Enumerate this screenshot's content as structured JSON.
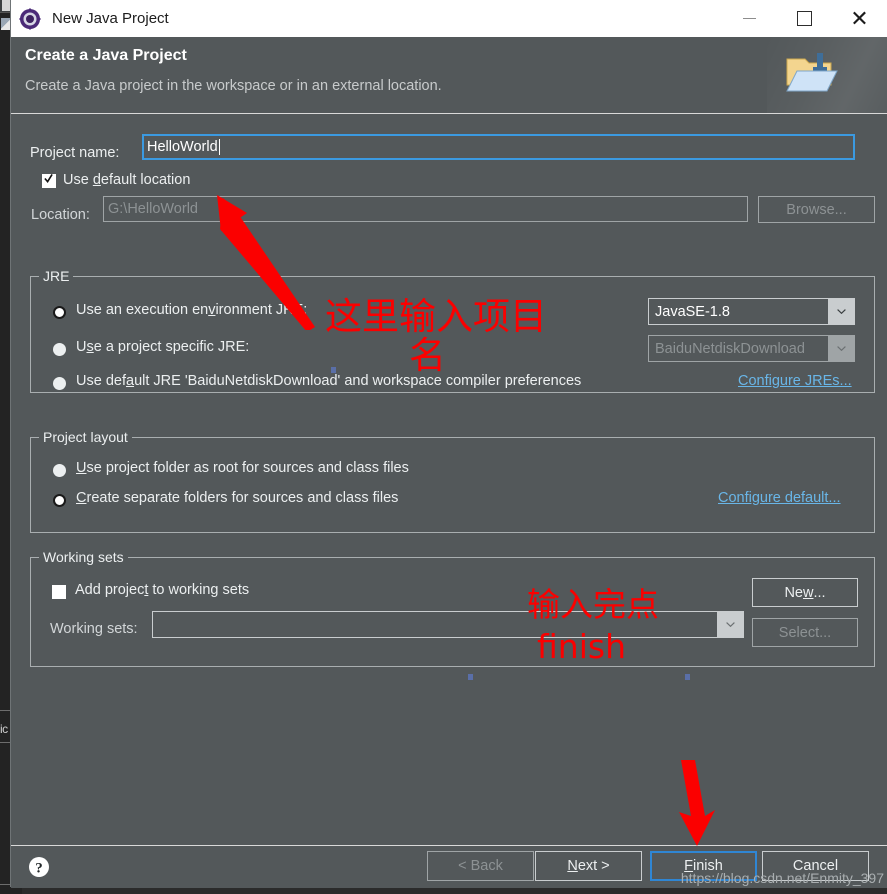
{
  "window": {
    "title": "New Java Project",
    "icon": "eclipse-wizard-icon",
    "minimize_label": "—",
    "maximize_label": "□",
    "close_label": "✕"
  },
  "header": {
    "title": "Create a Java Project",
    "subtitle": "Create a Java project in the workspace or in an external location.",
    "banner_icon": "new-java-project-folder-icon"
  },
  "form": {
    "project_name_label": "Project name:",
    "project_name_value": "HelloWorld",
    "use_default_location_label": "Use default location",
    "use_default_location_checked": true,
    "location_label": "Location:",
    "location_value": "G:\\HelloWorld",
    "browse_label": "Browse...",
    "browse_enabled": false
  },
  "jre": {
    "legend": "JRE",
    "option_exec_env_label": "Use an execution environment JRE:",
    "option_exec_env_selected": true,
    "option_specific_label": "Use a project specific JRE:",
    "option_specific_selected": false,
    "option_default_label": "Use default JRE 'BaiduNetdiskDownload' and workspace compiler preferences",
    "option_default_selected": false,
    "exec_env_value": "JavaSE-1.8",
    "specific_jre_value": "BaiduNetdiskDownload",
    "specific_jre_enabled": false,
    "configure_link": "Configure JREs..."
  },
  "project_layout": {
    "legend": "Project layout",
    "option_root_label": "Use project folder as root for sources and class files",
    "option_root_selected": false,
    "option_separate_label": "Create separate folders for sources and class files",
    "option_separate_selected": true,
    "configure_link": "Configure default..."
  },
  "working_sets": {
    "legend": "Working sets",
    "add_to_working_sets_label": "Add project to working sets",
    "add_to_working_sets_checked": false,
    "working_sets_label": "Working sets:",
    "working_sets_value": "",
    "new_label": "New...",
    "select_label": "Select...",
    "select_enabled": false
  },
  "footer": {
    "help_icon": "help-question-icon",
    "back_label": "< Back",
    "back_enabled": false,
    "next_label": "Next >",
    "finish_label": "Finish",
    "cancel_label": "Cancel",
    "default_button": "Finish"
  },
  "annotations": {
    "note_project_name": "这里输入项目\n名",
    "note_finish_line1": "输入完点",
    "note_finish_line2": "finish",
    "arrow_color": "#fb0000",
    "watermark": "https://blog.csdn.net/Enmity_397"
  },
  "background": {
    "side_text": "ic"
  },
  "colors": {
    "dialog_bg": "#53585a",
    "titlebar_bg": "#ffffff",
    "accent_blue": "#3b9ae1",
    "link_blue": "#69b6e8",
    "annotation_red": "#fb0000"
  }
}
